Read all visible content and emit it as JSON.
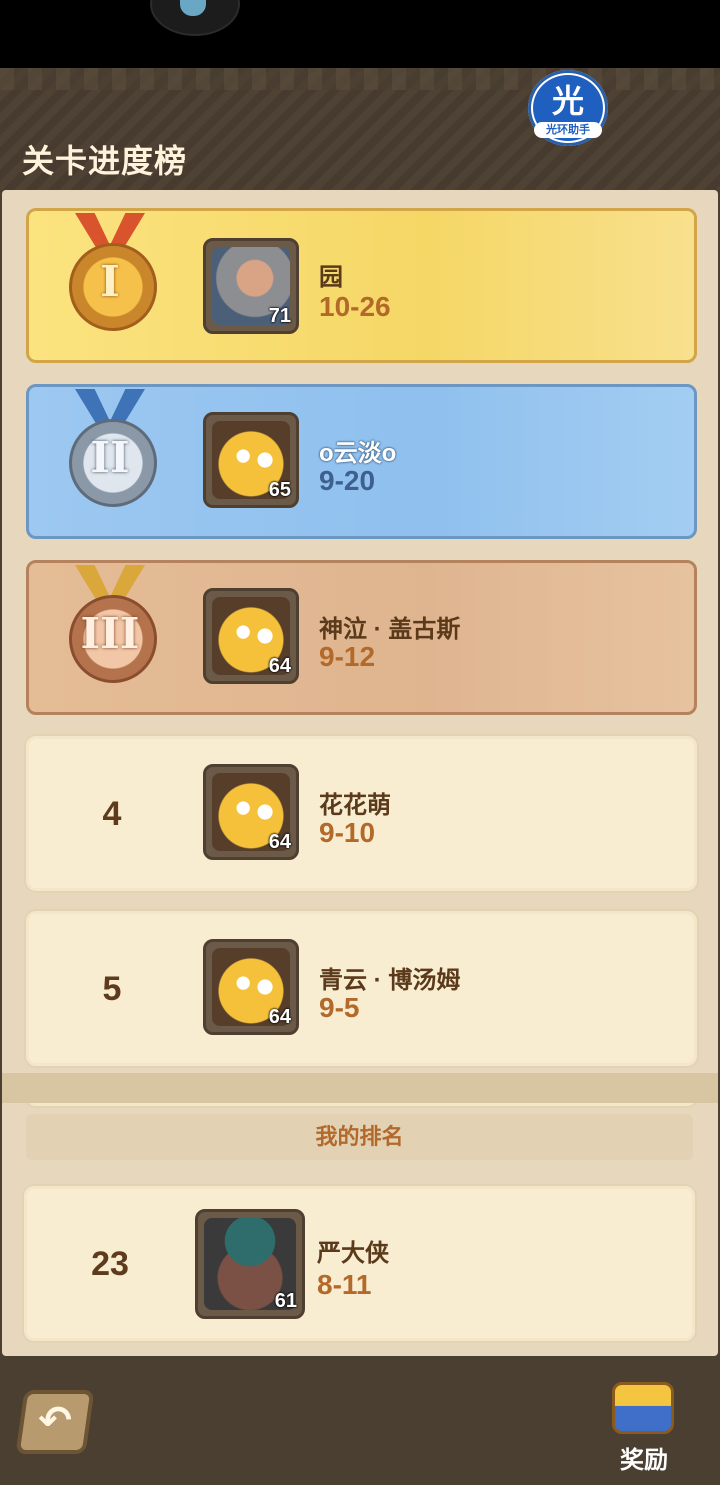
{
  "header": {
    "title": "关卡进度榜",
    "badge_big": "光",
    "badge_small": "光环助手"
  },
  "leaderboard": [
    {
      "rank": "I",
      "medal": "gold",
      "name": "园",
      "level": "71",
      "stage": "10-26",
      "avatar": "old-man-portrait"
    },
    {
      "rank": "II",
      "medal": "silver",
      "name": "o云淡o",
      "level": "65",
      "stage": "9-20",
      "avatar": "yellow-creature-portrait"
    },
    {
      "rank": "III",
      "medal": "bronze",
      "name": "神泣 · 盖古斯",
      "level": "64",
      "stage": "9-12",
      "avatar": "yellow-creature-portrait"
    },
    {
      "rank": "4",
      "name": "花花萌",
      "level": "64",
      "stage": "9-10",
      "avatar": "yellow-creature-portrait"
    },
    {
      "rank": "5",
      "name": "青云 · 博汤姆",
      "level": "64",
      "stage": "9-5",
      "avatar": "yellow-creature-portrait"
    }
  ],
  "my_rank": {
    "title": "我的排名",
    "rank": "23",
    "name": "严大侠",
    "level": "61",
    "stage": "8-11",
    "avatar": "hippo-portrait"
  },
  "footer": {
    "back_icon": "back-arrow-icon",
    "reward_label": "奖励",
    "reward_icon": "treasure-chest-icon"
  },
  "colors": {
    "gold": "#f5d766",
    "silver": "#8fc0ee",
    "bronze": "#dfb590",
    "stage_text": "#b2692a"
  }
}
